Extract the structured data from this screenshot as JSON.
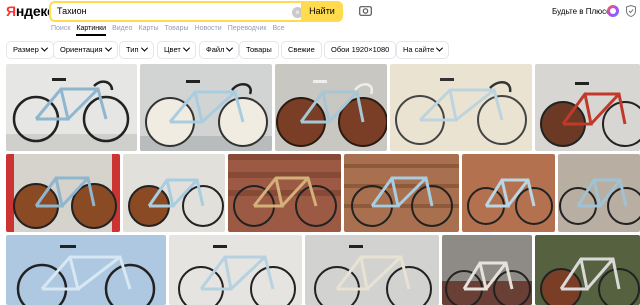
{
  "header": {
    "logo_ya": "Я",
    "logo_rest": "ндекс",
    "search_value": "Тахион",
    "search_button": "Найти",
    "plus_label": "Будьте в Плюсе"
  },
  "tabs": [
    "Поиск",
    "Картинки",
    "Видео",
    "Карты",
    "Товары",
    "Новости",
    "Переводчик",
    "Все"
  ],
  "active_tab": "Картинки",
  "filters": [
    {
      "label": "Размер",
      "dropdown": true
    },
    {
      "label": "Ориентация",
      "dropdown": true
    },
    {
      "label": "Тип",
      "dropdown": true
    },
    {
      "label": "Цвет",
      "dropdown": true
    },
    {
      "label": "Файл",
      "dropdown": true
    },
    {
      "label": "Товары",
      "dropdown": false
    },
    {
      "label": "Свежие",
      "dropdown": false
    },
    {
      "label": "Обои 1920×1080",
      "dropdown": false
    },
    {
      "label": "На сайте",
      "dropdown": true
    }
  ],
  "icons": {
    "camera": "camera-icon",
    "clear": "clear-icon",
    "plus": "plus-badge-icon",
    "shield": "shield-icon"
  },
  "colors": {
    "accent": "#ffdb4d",
    "logo_red": "#ff3333",
    "tab_inactive": "#919cb5"
  }
}
